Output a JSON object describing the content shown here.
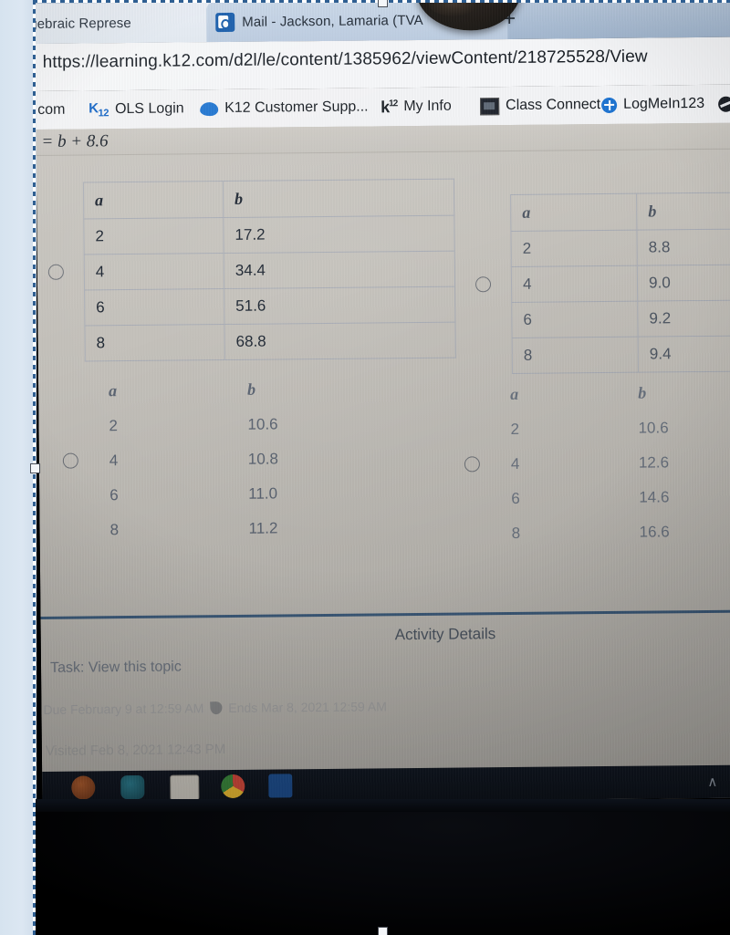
{
  "browser": {
    "tabs": [
      {
        "title": "gebraic Represe",
        "active": false,
        "close_label": "✕",
        "icon": "none"
      },
      {
        "title": "Mail - Jackson, Lamaria (TVA",
        "active": true,
        "close_label": "✕",
        "icon": "outlook-icon"
      }
    ],
    "new_tab_label": "+",
    "url": "https://learning.k12.com/d2l/le/content/1385962/viewContent/218725528/View",
    "bookmarks": [
      {
        "label": "com",
        "icon": "none"
      },
      {
        "label": "OLS Login",
        "icon": "k12-logo-icon"
      },
      {
        "label": "K12 Customer Supp...",
        "icon": "blue-blob-icon"
      },
      {
        "label": "My Info",
        "icon": "k12-superscript-icon"
      },
      {
        "label": "Class Connect",
        "icon": "dark-square-icon"
      },
      {
        "label": "LogMeIn123",
        "icon": "blue-plus-icon"
      },
      {
        "label": "",
        "icon": "globe-icon"
      }
    ]
  },
  "page": {
    "equation_fragment": "= b + 8.6",
    "options": [
      {
        "id": "option-1",
        "selected": false,
        "headers": [
          "a",
          "b"
        ],
        "rows": [
          [
            "2",
            "17.2"
          ],
          [
            "4",
            "34.4"
          ],
          [
            "6",
            "51.6"
          ],
          [
            "8",
            "68.8"
          ]
        ]
      },
      {
        "id": "option-2",
        "selected": false,
        "headers": [
          "a",
          "b"
        ],
        "rows": [
          [
            "2",
            "8.8"
          ],
          [
            "4",
            "9.0"
          ],
          [
            "6",
            "9.2"
          ],
          [
            "8",
            "9.4"
          ]
        ]
      },
      {
        "id": "option-3",
        "selected": false,
        "headers": [
          "a",
          "b"
        ],
        "rows": [
          [
            "2",
            "10.6"
          ],
          [
            "4",
            "10.8"
          ],
          [
            "6",
            "11.0"
          ],
          [
            "8",
            "11.2"
          ]
        ]
      },
      {
        "id": "option-4",
        "selected": false,
        "headers": [
          "a",
          "b"
        ],
        "rows": [
          [
            "2",
            "10.6"
          ],
          [
            "4",
            "12.6"
          ],
          [
            "6",
            "14.6"
          ],
          [
            "8",
            "16.6"
          ]
        ]
      }
    ],
    "activity": {
      "title": "Activity Details",
      "task": "Task: View this topic",
      "meta_due": "Due February 9 at 12:59 AM",
      "meta_ends": "Ends Mar 8, 2021 12:59 AM",
      "visited": "Visited Feb 8, 2021 12:43 PM"
    }
  },
  "taskbar": {
    "items": [
      {
        "name": "firefox-icon",
        "color": "#8c4a28"
      },
      {
        "name": "teal-app-icon",
        "color": "#1f5e6e"
      },
      {
        "name": "terms-of-use-document-icon",
        "color": "#cfcbc2"
      },
      {
        "name": "chrome-icon",
        "color": "#2f3a45"
      },
      {
        "name": "word-icon",
        "color": "#1d4f91"
      }
    ],
    "overflow_label": "∧"
  },
  "overlay": {
    "selection_active": true
  }
}
